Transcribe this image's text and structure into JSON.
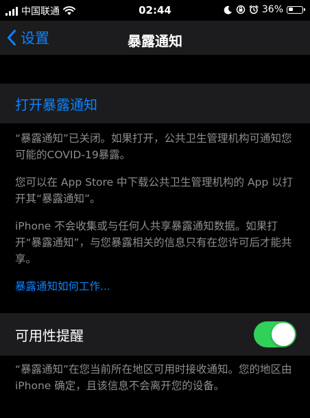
{
  "status_bar": {
    "carrier": "中国联通",
    "time": "02:44",
    "battery_percent": "36%",
    "battery_level": 0.36,
    "icons": [
      "signal-icon",
      "wifi-icon",
      "moon-icon",
      "orientation-lock-icon",
      "alarm-icon",
      "battery-icon"
    ]
  },
  "nav": {
    "back_label": "设置",
    "title": "暴露通知"
  },
  "turn_on": {
    "label": "打开暴露通知"
  },
  "footer": {
    "p1": "“暴露通知”已关闭。如果打开，公共卫生管理机构可通知您可能的COVID-19暴露。",
    "p2": "您可以在 App Store 中下载公共卫生管理机构的 App 以打开其“暴露通知”。",
    "p3": "iPhone 不会收集或与任何人共享暴露通知数据。如果打开“暴露通知”，与您暴露相关的信息只有在您许可后才能共享。",
    "link": "暴露通知如何工作..."
  },
  "availability": {
    "label": "可用性提醒",
    "toggle_on": true,
    "footer": "“暴露通知”在您当前所在地区可用时接收通知。您的地区由 iPhone 确定，且该信息不会离开您的设备。"
  },
  "colors": {
    "background": "#000000",
    "cell_background": "#1c1c1e",
    "accent_blue": "#0a84ff",
    "toggle_green": "#30d158",
    "secondary_text": "#8e8e93"
  }
}
